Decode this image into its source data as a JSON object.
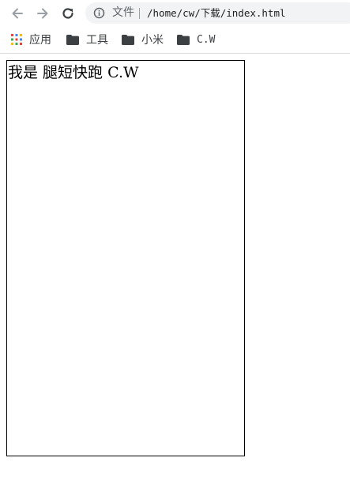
{
  "toolbar": {
    "back_icon": "arrow-left-icon",
    "forward_icon": "arrow-right-icon",
    "reload_icon": "reload-icon",
    "omnibox": {
      "info_icon": "info-icon",
      "scheme_label": "文件",
      "url": "/home/cw/下载/index.html"
    }
  },
  "bookmarks": {
    "apps": {
      "label": "应用",
      "icon": "apps-grid-icon"
    },
    "items": [
      {
        "label": "工具",
        "icon": "folder-icon"
      },
      {
        "label": "小米",
        "icon": "folder-icon"
      },
      {
        "label": "C.W",
        "icon": "folder-icon"
      }
    ]
  },
  "page": {
    "text_cjk": "我是 腿短快跑 ",
    "text_latin": "C.W"
  },
  "colors": {
    "omnibox_bg": "#f1f3f4",
    "icon_gray": "#5f6368",
    "folder_dark": "#3c4043",
    "box_border": "#000000"
  }
}
